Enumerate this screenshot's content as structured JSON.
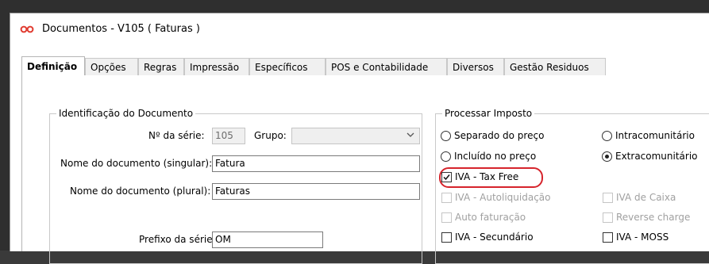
{
  "window": {
    "title": "Documentos - V105 ( Faturas )"
  },
  "tabs": [
    {
      "label": "Definição",
      "active": true
    },
    {
      "label": "Opções"
    },
    {
      "label": "Regras"
    },
    {
      "label": "Impressão"
    },
    {
      "label": "Específicos"
    },
    {
      "label": "POS e Contabilidade"
    },
    {
      "label": "Diversos"
    },
    {
      "label": "Gestão Residuos"
    }
  ],
  "identificacao": {
    "title": "Identificação do Documento",
    "serie_label": "Nº da série:",
    "serie_value": "105",
    "grupo_label": "Grupo:",
    "grupo_value": "",
    "nome_singular_label": "Nome do documento (singular):",
    "nome_singular_value": "Fatura",
    "nome_plural_label": "Nome do documento (plural):",
    "nome_plural_value": "Faturas",
    "prefixo_label": "Prefixo da série:",
    "prefixo_value": "OM"
  },
  "imposto": {
    "title": "Processar Imposto",
    "separado": "Separado do preço",
    "intracomunitario": "Intracomunitário",
    "incluido": "Incluído no preço",
    "extracomunitario": "Extracomunitário",
    "selected": "Extracomunitário",
    "iva_tax_free": "IVA - Tax Free",
    "iva_tax_free_checked": true,
    "iva_autoliquidacao": "IVA - Autoliquidação",
    "iva_caixa": "IVA de Caixa",
    "auto_faturacao": "Auto faturação",
    "reverse_charge": "Reverse charge",
    "iva_secundario": "IVA - Secundário",
    "iva_moss": "IVA - MOSS"
  },
  "colors": {
    "highlight": "#d6242c",
    "icon": "#e03a2f"
  },
  "icons": {
    "app": "infinity-icon",
    "dropdown": "chevron-down-icon",
    "check": "checkmark-icon"
  }
}
